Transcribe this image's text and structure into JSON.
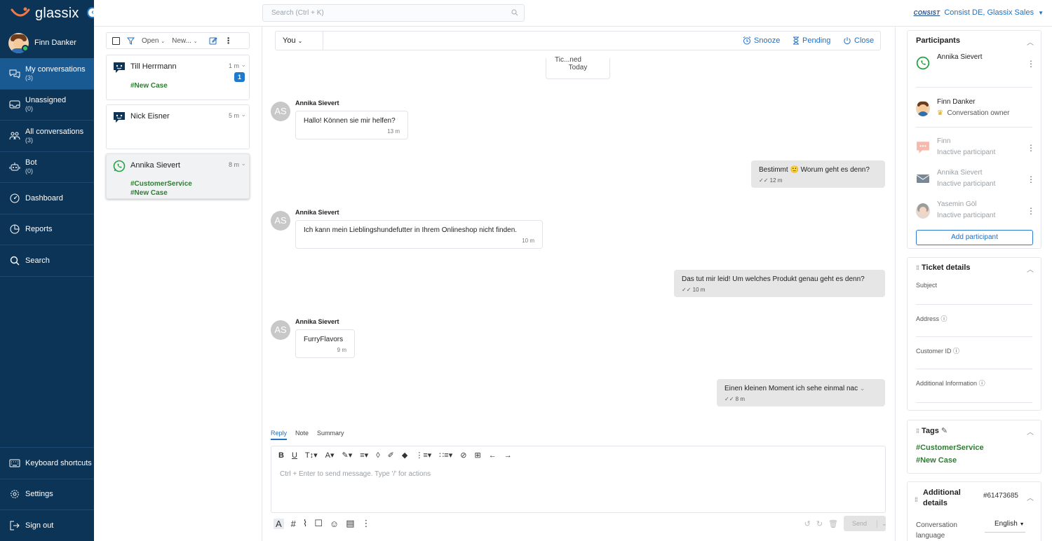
{
  "brand": {
    "name": "glassix",
    "accent": "#1f6fc5",
    "sidebar_bg": "#0c3457"
  },
  "user": {
    "name": "Finn Danker"
  },
  "nav": [
    {
      "label": "My conversations",
      "count": "(3)",
      "icon": "chat-bubbles-icon"
    },
    {
      "label": "Unassigned",
      "count": "(0)",
      "icon": "inbox-icon"
    },
    {
      "label": "All conversations",
      "count": "(3)",
      "icon": "people-icon"
    },
    {
      "label": "Bot",
      "count": "(0)",
      "icon": "robot-icon"
    },
    {
      "label": "Dashboard",
      "count": "",
      "icon": "dashboard-icon"
    },
    {
      "label": "Reports",
      "count": "",
      "icon": "pie-chart-icon"
    },
    {
      "label": "Search",
      "count": "",
      "icon": "search-icon"
    }
  ],
  "nav_bottom": [
    {
      "label": "Keyboard shortcuts",
      "icon": "keyboard-icon"
    },
    {
      "label": "Settings",
      "icon": "gear-icon"
    },
    {
      "label": "Sign out",
      "icon": "sign-out-icon"
    }
  ],
  "topbar": {
    "search_placeholder": "Search (Ctrl + K)",
    "org_logo": "CONSIST",
    "org_name": "Consist DE, Glassix Sales"
  },
  "list": {
    "filter_status": "Open",
    "filter_sort": "New...",
    "conversations": [
      {
        "name": "Till Herrmann",
        "time": "1 m",
        "tags": [
          "#New Case"
        ],
        "unread": "1",
        "channel": "webchat"
      },
      {
        "name": "Nick Eisner",
        "time": "5 m",
        "tags": [],
        "unread": "",
        "channel": "webchat"
      },
      {
        "name": "Annika Sievert",
        "time": "8 m",
        "tags": [
          "#CustomerService",
          "#New Case"
        ],
        "unread": "",
        "channel": "whatsapp"
      }
    ]
  },
  "chat": {
    "assignee": "You",
    "actions": {
      "snooze": "Snooze",
      "pending": "Pending",
      "close": "Close"
    },
    "ticket_pill": {
      "top": "Tic...ned",
      "day": "Today"
    },
    "messages": [
      {
        "dir": "in",
        "sender": "Annika Sievert",
        "initials": "AS",
        "text": "Hallo! Können sie mir helfen?",
        "time": "13 m"
      },
      {
        "dir": "out",
        "text": "Bestimmt 🙂 Worum geht es denn?",
        "time": "12 m"
      },
      {
        "dir": "in",
        "sender": "Annika Sievert",
        "initials": "AS",
        "text": "Ich kann mein Lieblingshundefutter in Ihrem Onlineshop nicht finden.",
        "time": "10 m"
      },
      {
        "dir": "out",
        "text": "Das tut mir leid! Um welches Produkt genau geht es denn?",
        "time": "10 m"
      },
      {
        "dir": "in",
        "sender": "Annika Sievert",
        "initials": "AS",
        "text": "FurryFlavors",
        "time": "9 m"
      },
      {
        "dir": "out",
        "text": "Einen kleinen Moment ich sehe einmal nac",
        "time": "8 m"
      }
    ],
    "composer": {
      "tabs": [
        "Reply",
        "Note",
        "Summary"
      ],
      "placeholder": "Ctrl + Enter to send message. Type '/' for actions",
      "send_label": "Send"
    }
  },
  "right_panel": {
    "participants": {
      "title": "Participants",
      "items": [
        {
          "name": "Annika Sievert",
          "role": "",
          "icon": "whatsapp-icon",
          "inactive": false
        },
        {
          "name": "Finn Danker",
          "role": "Conversation owner",
          "icon": "avatar",
          "inactive": false
        },
        {
          "name": "Finn",
          "role": "Inactive participant",
          "icon": "webchat-icon",
          "inactive": true
        },
        {
          "name": "Annika Sievert",
          "role": "Inactive participant",
          "icon": "mail-icon",
          "inactive": true
        },
        {
          "name": "Yasemin Göl",
          "role": "Inactive participant",
          "icon": "avatar",
          "inactive": true
        }
      ],
      "add_label": "Add participant"
    },
    "ticket_details": {
      "title": "Ticket details",
      "fields": [
        "Subject",
        "Address",
        "Customer ID",
        "Additional Information"
      ]
    },
    "tags": {
      "title": "Tags",
      "items": [
        "#CustomerService",
        "#New Case"
      ]
    },
    "additional": {
      "title": "Additional details",
      "ticket_id": "#61473685",
      "language_label": "Conversation language",
      "language_value": "English"
    }
  }
}
